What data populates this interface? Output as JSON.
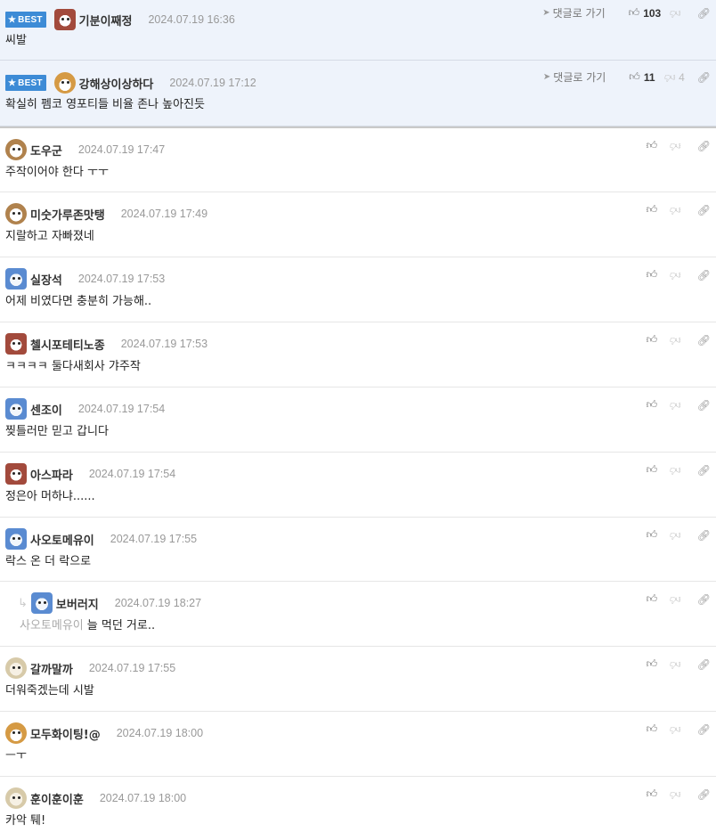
{
  "best_label": "BEST",
  "goto_label": "댓글로 가기",
  "comments": [
    {
      "nick": "기분이째정",
      "date": "2024.07.19 16:36",
      "text": "씨발",
      "up": "103",
      "down": ""
    },
    {
      "nick": "강해상이상하다",
      "date": "2024.07.19 17:12",
      "text": "확실히 펨코 영포티들 비율 존나 높아진듯",
      "up": "11",
      "down": "4"
    },
    {
      "nick": "도우군",
      "date": "2024.07.19 17:47",
      "text": "주작이어야 한다 ㅜㅜ"
    },
    {
      "nick": "미숫가루존맛탱",
      "date": "2024.07.19 17:49",
      "text": "지랄하고 자빠졌네"
    },
    {
      "nick": "실장석",
      "date": "2024.07.19 17:53",
      "text": "어제 비였다면 충분히 가능해.."
    },
    {
      "nick": "첼시포테티노종",
      "date": "2024.07.19 17:53",
      "text": "ㅋㅋㅋㅋ 둘다새회사 갸주작"
    },
    {
      "nick": "센조이",
      "date": "2024.07.19 17:54",
      "text": "찢틀러만 믿고 갑니다"
    },
    {
      "nick": "아스파라",
      "date": "2024.07.19 17:54",
      "text": "정은아 머하냐......"
    },
    {
      "nick": "사오토메유이",
      "date": "2024.07.19 17:55",
      "text": "락스 온 더 락으로"
    },
    {
      "nick": "보버러지",
      "date": "2024.07.19 18:27",
      "text": "늘 먹던 거로..",
      "mention": "사오토메유이"
    },
    {
      "nick": "갈까말까",
      "date": "2024.07.19 17:55",
      "text": "더워죽겠는데 시발"
    },
    {
      "nick": "모두화이팅!@",
      "date": "2024.07.19 18:00",
      "text": "ㅡㅜ"
    },
    {
      "nick": "훈이훈이훈",
      "date": "2024.07.19 18:00",
      "text": "카악 퉤!"
    }
  ]
}
